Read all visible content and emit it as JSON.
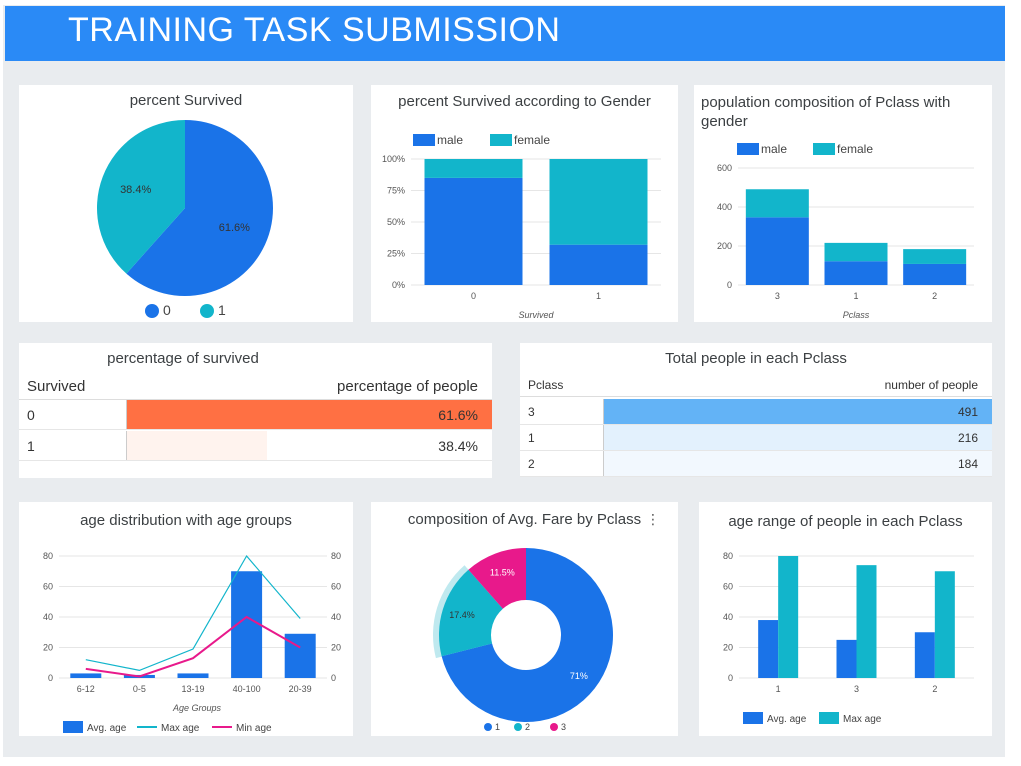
{
  "header": {
    "title": "TRAINING TASK SUBMISSION"
  },
  "colors": {
    "blue": "#1a73e8",
    "teal": "#12b5cb",
    "magenta": "#e8198b",
    "header": "#2a8af6",
    "orange": "#ff7043",
    "light_blue": "#64b5f6"
  },
  "chart_data": [
    {
      "id": "pie_survived",
      "type": "pie",
      "title": "percent Survived",
      "categories": [
        "0",
        "1"
      ],
      "values": [
        61.6,
        38.4
      ],
      "labels": [
        "61.6%",
        "38.4%"
      ],
      "legend": "bottom"
    },
    {
      "id": "stacked_gender",
      "type": "bar",
      "stacked": "percent",
      "title": "percent Survived according to Gender",
      "xlabel": "Survived",
      "categories": [
        "0",
        "1"
      ],
      "series": [
        {
          "name": "male",
          "values": [
            85,
            32
          ]
        },
        {
          "name": "female",
          "values": [
            15,
            68
          ]
        }
      ],
      "yticks": [
        "0%",
        "25%",
        "50%",
        "75%",
        "100%"
      ],
      "ylim": [
        0,
        100
      ],
      "legend": "top-left"
    },
    {
      "id": "stacked_pclass",
      "type": "bar",
      "stacked": true,
      "title": "population composition of Pclass with gender",
      "xlabel": "Pclass",
      "categories": [
        "3",
        "1",
        "2"
      ],
      "series": [
        {
          "name": "male",
          "values": [
            347,
            122,
            108
          ]
        },
        {
          "name": "female",
          "values": [
            144,
            94,
            76
          ]
        }
      ],
      "yticks": [
        "0",
        "200",
        "400",
        "600"
      ],
      "ylim": [
        0,
        600
      ],
      "legend": "top-left"
    },
    {
      "id": "age_groups",
      "type": "bar",
      "title": "age distribution with age groups",
      "xlabel": "Age Groups",
      "categories": [
        "6-12",
        "0-5",
        "13-19",
        "40-100",
        "20-39"
      ],
      "series": [
        {
          "name": "Avg. age",
          "kind": "bar",
          "values": [
            3,
            2,
            3,
            70,
            29
          ]
        },
        {
          "name": "Max age",
          "kind": "line",
          "values": [
            12,
            5,
            19,
            80,
            39
          ]
        },
        {
          "name": "Min age",
          "kind": "line",
          "values": [
            6,
            1,
            13,
            40,
            20
          ]
        }
      ],
      "yticks": [
        "0",
        "20",
        "40",
        "60",
        "80"
      ],
      "ylim": [
        0,
        80
      ],
      "legend": "bottom"
    },
    {
      "id": "donut_fare",
      "type": "pie",
      "donut": true,
      "title": "composition of Avg. Fare by Pclass",
      "categories": [
        "1",
        "2",
        "3"
      ],
      "values": [
        71,
        17.4,
        11.5
      ],
      "labels": [
        "71%",
        "17.4%",
        "11.5%"
      ],
      "legend": "bottom"
    },
    {
      "id": "age_range",
      "type": "bar",
      "title": "age range of people in each Pclass",
      "categories": [
        "1",
        "3",
        "2"
      ],
      "series": [
        {
          "name": "Avg. age",
          "values": [
            38,
            25,
            30
          ]
        },
        {
          "name": "Max age",
          "values": [
            80,
            74,
            70
          ]
        }
      ],
      "yticks": [
        "0",
        "20",
        "40",
        "60",
        "80"
      ],
      "ylim": [
        0,
        80
      ],
      "legend": "bottom"
    },
    {
      "id": "table_survived",
      "type": "table",
      "title": "percentage of survived",
      "columns": [
        "Survived",
        "percentage of people"
      ],
      "rows": [
        [
          "0",
          "61.6%"
        ],
        [
          "1",
          "38.4%"
        ]
      ],
      "bar_values": [
        61.6,
        38.4
      ]
    },
    {
      "id": "table_pclass",
      "type": "table",
      "title": "Total people in each Pclass",
      "columns": [
        "Pclass",
        "number of people"
      ],
      "rows": [
        [
          "3",
          "491"
        ],
        [
          "1",
          "216"
        ],
        [
          "2",
          "184"
        ]
      ],
      "bar_values": [
        491,
        216,
        184
      ]
    }
  ]
}
